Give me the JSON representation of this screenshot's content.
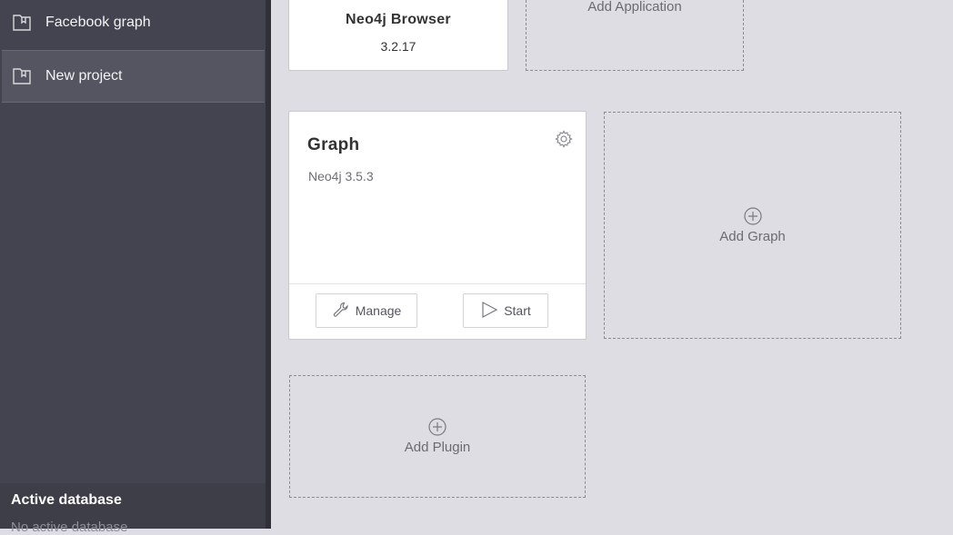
{
  "sidebar": {
    "projects": [
      {
        "label": "Facebook graph",
        "icon": "project-folder-icon"
      },
      {
        "label": "New project",
        "icon": "project-folder-icon",
        "selected": true
      }
    ],
    "active_db": {
      "title": "Active database",
      "subtitle": "No active database"
    }
  },
  "applications": {
    "app": {
      "name": "Neo4j Browser",
      "version": "3.2.17"
    },
    "add_label": "Add Application"
  },
  "graphs": {
    "card": {
      "title": "Graph",
      "version": "Neo4j 3.5.3",
      "manage_label": "Manage",
      "start_label": "Start"
    },
    "add_label": "Add Graph"
  },
  "plugins": {
    "add_label": "Add Plugin"
  },
  "colors": {
    "sidebar_bg": "#43444f",
    "main_bg": "#dedde3",
    "card_bg": "#ffffff"
  }
}
